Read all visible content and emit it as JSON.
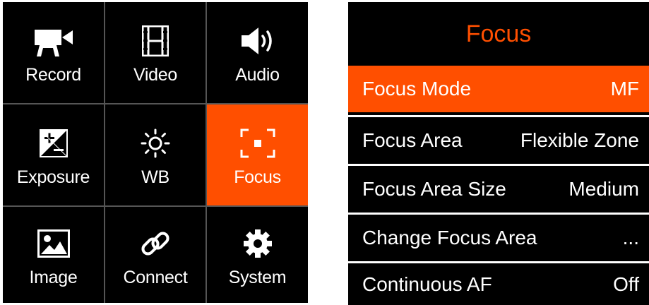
{
  "main_menu": {
    "items": [
      {
        "label": "Record",
        "icon": "video-camera-icon",
        "active": false
      },
      {
        "label": "Video",
        "icon": "film-icon",
        "active": false
      },
      {
        "label": "Audio",
        "icon": "speaker-icon",
        "active": false
      },
      {
        "label": "Exposure",
        "icon": "exposure-compensation-icon",
        "active": false
      },
      {
        "label": "WB",
        "icon": "sun-icon",
        "active": false
      },
      {
        "label": "Focus",
        "icon": "focus-frame-icon",
        "active": true
      },
      {
        "label": "Image",
        "icon": "image-icon",
        "active": false
      },
      {
        "label": "Connect",
        "icon": "link-icon",
        "active": false
      },
      {
        "label": "System",
        "icon": "gear-icon",
        "active": false
      }
    ]
  },
  "submenu": {
    "title": "Focus",
    "rows": [
      {
        "label": "Focus Mode",
        "value": "MF",
        "selected": true
      },
      {
        "label": "Focus Area",
        "value": "Flexible Zone",
        "selected": false
      },
      {
        "label": "Focus Area Size",
        "value": "Medium",
        "selected": false
      },
      {
        "label": "Change Focus Area",
        "value": "...",
        "selected": false
      },
      {
        "label": "Continuous AF",
        "value": "Off",
        "selected": false
      }
    ]
  },
  "colors": {
    "accent": "#ff4f00",
    "background": "#000000",
    "text": "#ffffff",
    "divider": "#555555"
  }
}
